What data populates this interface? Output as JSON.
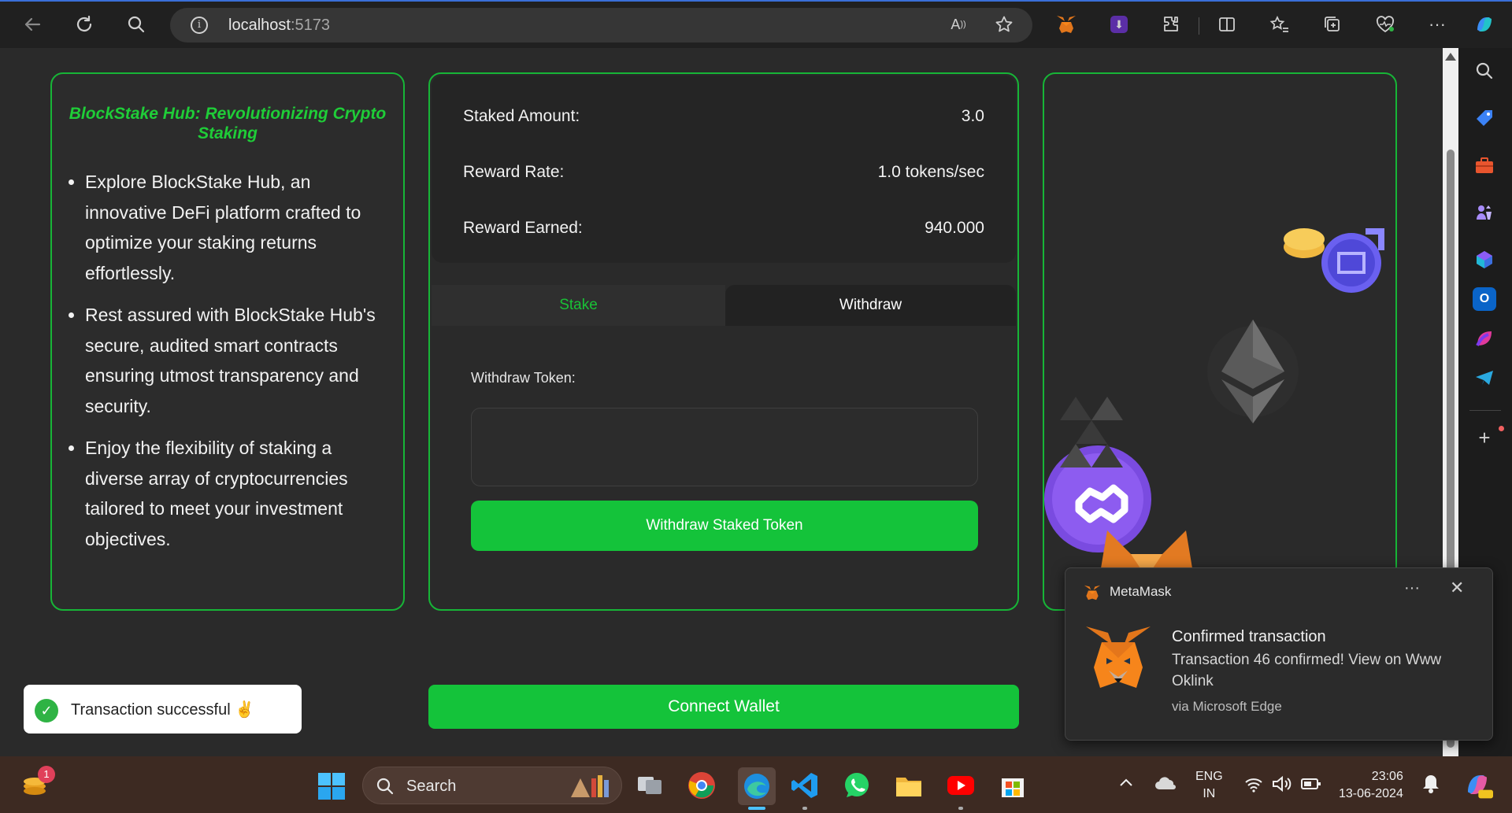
{
  "browser": {
    "url_host": "localhost",
    "url_port": ":5173"
  },
  "info": {
    "title": "BlockStake Hub: Revolutionizing Crypto Staking",
    "points": [
      "Explore BlockStake Hub, an innovative DeFi platform crafted to optimize your staking returns effortlessly.",
      "Rest assured with BlockStake Hub's secure, audited smart contracts ensuring utmost transparency and security.",
      "Enjoy the flexibility of staking a diverse array of cryptocurrencies tailored to meet your investment objectives."
    ]
  },
  "stats": {
    "staked_label": "Staked Amount:",
    "staked_value": "3.0",
    "rate_label": "Reward Rate:",
    "rate_value": "1.0 tokens/sec",
    "earned_label": "Reward Earned:",
    "earned_value": "940.000"
  },
  "tabs": {
    "stake": "Stake",
    "withdraw": "Withdraw",
    "active": "withdraw"
  },
  "withdraw": {
    "label": "Withdraw Token:",
    "value": "",
    "button": "Withdraw Staked Token"
  },
  "connect_button": "Connect Wallet",
  "toast": {
    "text": "Transaction successful ✌️",
    "status_color": "#2fb344"
  },
  "notification": {
    "app": "MetaMask",
    "title": "Confirmed transaction",
    "body": "Transaction 46 confirmed! View on Www Oklink",
    "via": "via Microsoft Edge"
  },
  "taskbar": {
    "search": "Search",
    "lang_top": "ENG",
    "lang_bottom": "IN",
    "time": "23:06",
    "date": "13-06-2024",
    "badge": "1"
  },
  "colors": {
    "accent": "#17b537",
    "button": "#14c33a",
    "background": "#2a2a2a"
  }
}
